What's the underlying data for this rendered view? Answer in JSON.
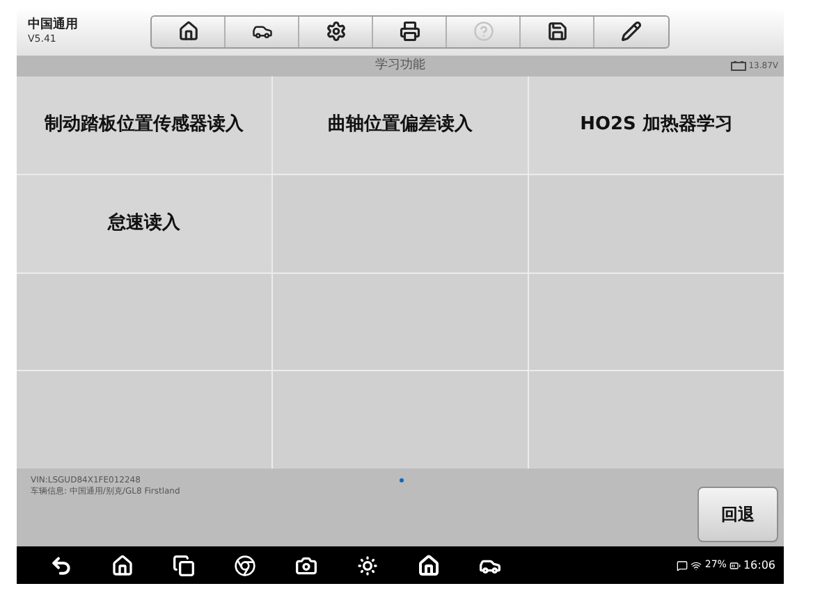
{
  "header": {
    "brand": "中国通用",
    "version": "V5.41",
    "toolbar": [
      {
        "kind": "home",
        "disabled": false
      },
      {
        "kind": "vehicle",
        "disabled": false
      },
      {
        "kind": "settings",
        "disabled": false
      },
      {
        "kind": "print",
        "disabled": false
      },
      {
        "kind": "help",
        "disabled": true
      },
      {
        "kind": "save",
        "disabled": false
      },
      {
        "kind": "edit",
        "disabled": false
      }
    ]
  },
  "title_bar": {
    "title": "学习功能",
    "voltage": "13.87V"
  },
  "functions": [
    {
      "kind": "item",
      "label": "制动踏板位置传感器读入"
    },
    {
      "kind": "item",
      "label": "曲轴位置偏差读入"
    },
    {
      "kind": "item",
      "label": "HO2S 加热器学习"
    },
    {
      "kind": "item",
      "label": "怠速读入"
    },
    {
      "kind": "empty"
    },
    {
      "kind": "empty"
    },
    {
      "kind": "empty"
    },
    {
      "kind": "empty"
    },
    {
      "kind": "empty"
    },
    {
      "kind": "empty"
    },
    {
      "kind": "empty"
    },
    {
      "kind": "empty"
    }
  ],
  "footer": {
    "vin": "VIN:LSGUD84X1FE012248",
    "vehicle_info": "车辆信息: 中国通用/别克/GL8 Firstland",
    "back_button": "回退"
  },
  "nav_bar": {
    "status": {
      "battery": "27%",
      "time": "16:06"
    }
  }
}
